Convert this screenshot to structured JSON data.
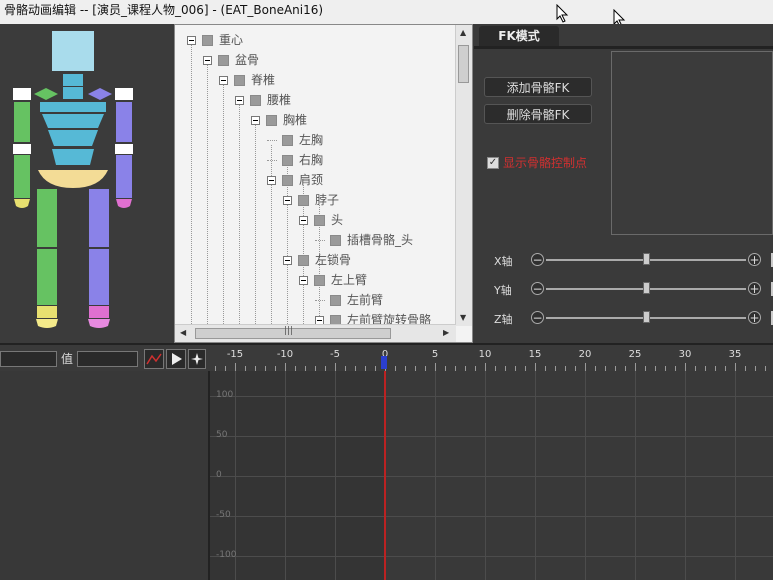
{
  "window": {
    "title": "骨骼动画编辑  -- [演员_课程人物_006] - (EAT_BoneAni16)"
  },
  "tree": {
    "nodes": [
      {
        "label": "重心",
        "expander": true
      },
      {
        "label": "盆骨",
        "expander": true
      },
      {
        "label": "脊椎",
        "expander": true
      },
      {
        "label": "腰椎",
        "expander": true
      },
      {
        "label": "胸椎",
        "expander": true
      },
      {
        "label": "左胸",
        "expander": false
      },
      {
        "label": "右胸",
        "expander": false
      },
      {
        "label": "肩颈",
        "expander": true
      },
      {
        "label": "脖子",
        "expander": true
      },
      {
        "label": "头",
        "expander": true
      },
      {
        "label": "插槽骨骼_头",
        "expander": false
      },
      {
        "label": "左锁骨",
        "expander": true
      },
      {
        "label": "左上臂",
        "expander": true
      },
      {
        "label": "左前臂",
        "expander": false
      },
      {
        "label": "左前臂旋转骨骼",
        "expander": true
      }
    ],
    "hscroll_grip": "|||"
  },
  "fk": {
    "tab_label": "FK模式",
    "add_button": "添加骨骼FK",
    "delete_button": "删除骨骼FK",
    "show_ctrl_label": "显示骨骼控制点",
    "show_ctrl_checked": true,
    "axes": [
      {
        "label": "X轴",
        "value": 0.5
      },
      {
        "label": "Y轴",
        "value": 0.5
      },
      {
        "label": "Z轴",
        "value": 0.5
      }
    ]
  },
  "timeline": {
    "value_label": "值",
    "ruler": [
      "-15",
      "-10",
      "-5",
      "0",
      "5",
      "10",
      "15",
      "20",
      "25",
      "30",
      "35"
    ],
    "y_labels": [
      "100",
      "50",
      "0",
      "-50",
      "-100"
    ],
    "current_frame": "0"
  },
  "colors": {
    "accent_red": "#d03030",
    "playhead": "#b22222",
    "bone_head": "#a9dcec",
    "bone_body": "#56b9d6",
    "bone_hip": "#f3dc96",
    "bone_left_arm": "#66c262",
    "bone_right_arm": "#8a82e8"
  }
}
